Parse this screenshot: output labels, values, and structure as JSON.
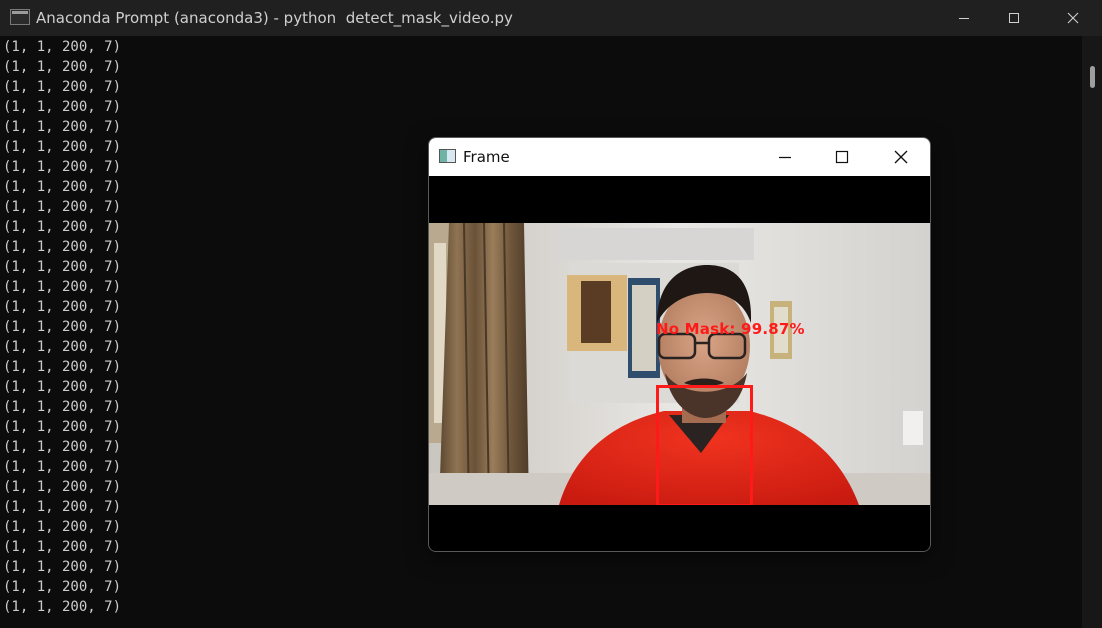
{
  "console": {
    "title": "Anaconda Prompt (anaconda3) - python  detect_mask_video.py",
    "lines": [
      "(1, 1, 200, 7)",
      "(1, 1, 200, 7)",
      "(1, 1, 200, 7)",
      "(1, 1, 200, 7)",
      "(1, 1, 200, 7)",
      "(1, 1, 200, 7)",
      "(1, 1, 200, 7)",
      "(1, 1, 200, 7)",
      "(1, 1, 200, 7)",
      "(1, 1, 200, 7)",
      "(1, 1, 200, 7)",
      "(1, 1, 200, 7)",
      "(1, 1, 200, 7)",
      "(1, 1, 200, 7)",
      "(1, 1, 200, 7)",
      "(1, 1, 200, 7)",
      "(1, 1, 200, 7)",
      "(1, 1, 200, 7)",
      "(1, 1, 200, 7)",
      "(1, 1, 200, 7)",
      "(1, 1, 200, 7)",
      "(1, 1, 200, 7)",
      "(1, 1, 200, 7)",
      "(1, 1, 200, 7)",
      "(1, 1, 200, 7)",
      "(1, 1, 200, 7)",
      "(1, 1, 200, 7)",
      "(1, 1, 200, 7)",
      "(1, 1, 200, 7)"
    ],
    "icons": {
      "app": "terminal-icon",
      "minimize": "minimize-icon",
      "maximize": "maximize-icon",
      "close": "close-icon"
    }
  },
  "frame_window": {
    "title": "Frame",
    "detection": {
      "label": "No Mask: 99.87%",
      "color": "#ff1a1a"
    },
    "icons": {
      "app": "opencv-window-icon",
      "minimize": "minimize-icon",
      "maximize": "maximize-icon",
      "close": "close-icon"
    }
  },
  "colors": {
    "console_bg": "#0c0c0c",
    "console_text": "#cccccc",
    "titlebar_bg": "#202020",
    "frame_titlebar_bg": "#ffffff"
  }
}
